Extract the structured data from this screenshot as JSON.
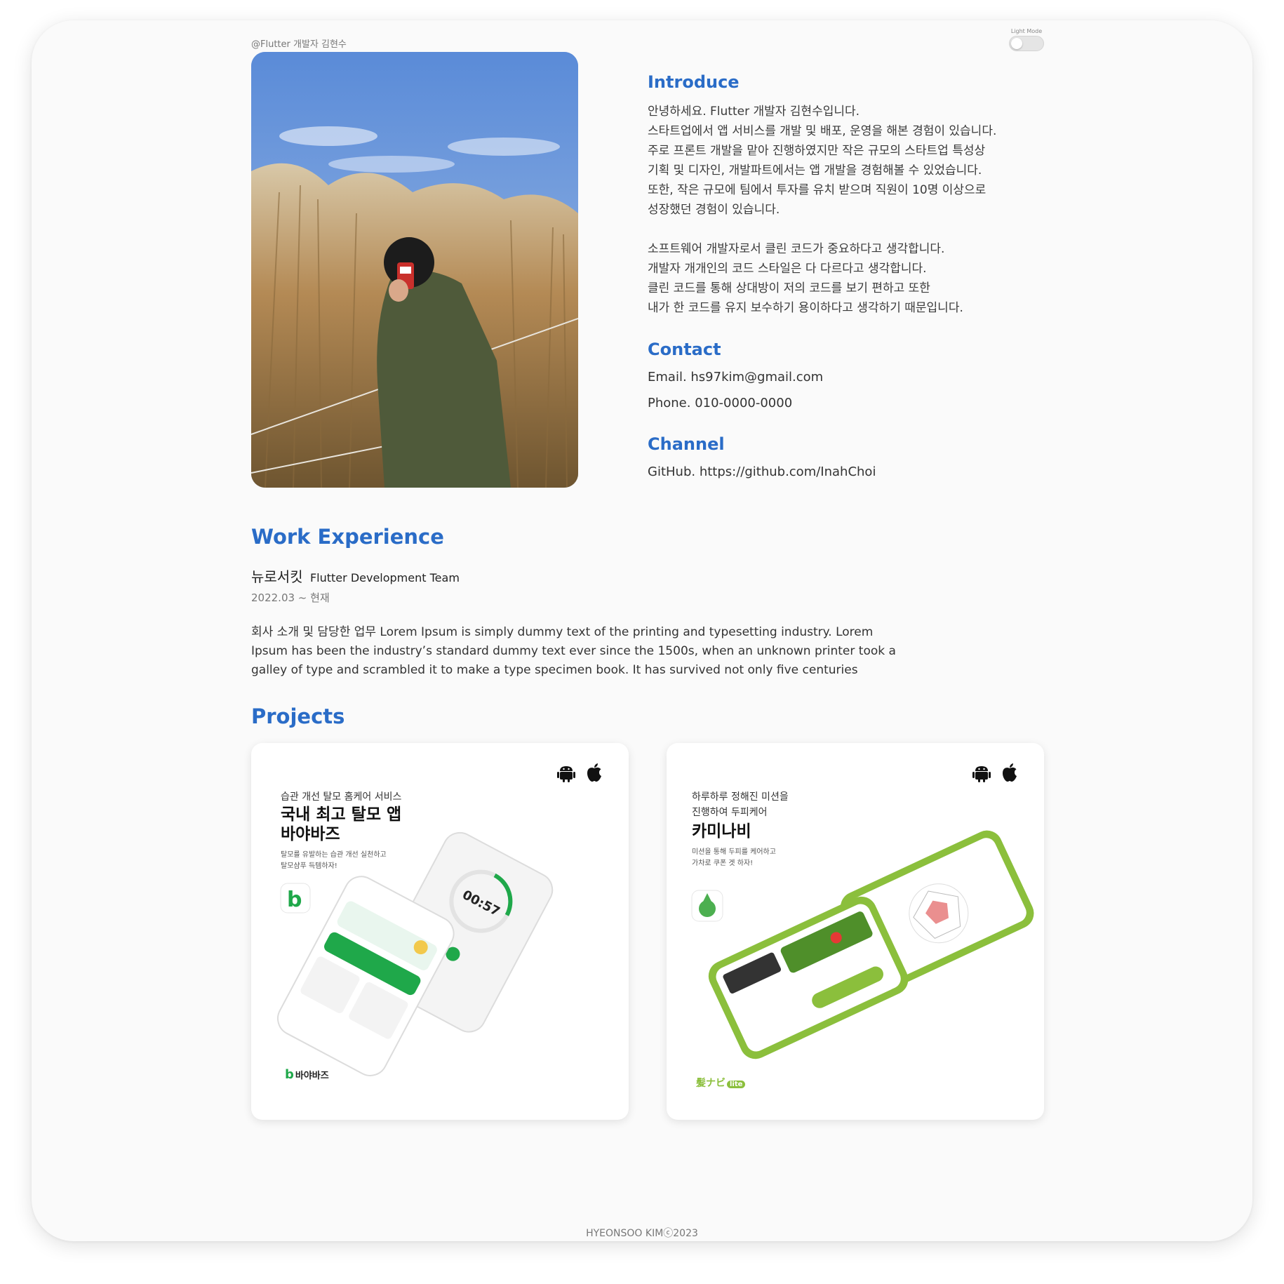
{
  "header": {
    "handle": "@Flutter 개발자 김현수",
    "theme_toggle_label": "Light Mode"
  },
  "profile": {
    "photo_icon": "profile-photo-icon"
  },
  "introduce": {
    "title": "Introduce",
    "paragraph1": [
      "안녕하세요. Flutter 개발자 김현수입니다.",
      "스타트업에서 앱 서비스를 개발 및 배포, 운영을 해본 경험이 있습니다.",
      "주로 프론트 개발을 맡아 진행하였지만 작은 규모의 스타트업 특성상",
      "기획 및 디자인, 개발파트에서는 앱 개발을 경험해볼 수 있었습니다.",
      "또한, 작은 규모에 팀에서 투자를 유치 받으며 직원이 10명 이상으로",
      "성장했던 경험이 있습니다."
    ],
    "paragraph2": [
      "소프트웨어 개발자로서 클린 코드가 중요하다고 생각합니다.",
      "개발자 개개인의 코드 스타일은 다 다르다고 생각합니다.",
      "클린 코드를 통해 상대방이 저의 코드를 보기 편하고 또한",
      "내가 한 코드를 유지 보수하기 용이하다고 생각하기 때문입니다."
    ]
  },
  "contact": {
    "title": "Contact",
    "email": "Email.  hs97kim@gmail.com",
    "phone": "Phone. 010-0000-0000"
  },
  "channel": {
    "title": "Channel",
    "github": "GitHub. https://github.com/InahChoi"
  },
  "work": {
    "title": "Work Experience",
    "company": "뉴로서킷",
    "team": "Flutter Development Team",
    "period": "2022.03 ~ 현재",
    "description": "회사 소개 및 담당한 업무 Lorem Ipsum is simply dummy text of the printing and typesetting industry. Lorem Ipsum has been the industry’s standard dummy text ever since the 1500s, when an unknown printer took a galley of type and scrambled it to make a type specimen book. It has survived not only five centuries"
  },
  "projects": {
    "title": "Projects",
    "items": [
      {
        "subtitle": "습관 개선 탈모 홈케어 서비스",
        "headline_line1": "국내 최고 탈모 앱",
        "headline_line2": "바야바즈",
        "desc_line1": "탈모를 유발하는 습관 개선 실천하고",
        "desc_line2": "탈모샴푸 득템하자!",
        "brand": "바야바즈",
        "brand_mark": "b",
        "timer": "00:57",
        "accent": "#1fa84a",
        "platforms": [
          "android-icon",
          "apple-icon"
        ]
      },
      {
        "subtitle_line1": "하루하루 정해진 미션을",
        "subtitle_line2": "진행하여 두피케어",
        "headline": "카미나비",
        "desc_line1": "미션을 통해 두피를 케어하고",
        "desc_line2": "가차로 쿠폰 겟 하자!",
        "brand": "髪ナビ",
        "brand_badge": "lite",
        "accent": "#8bbf3c",
        "platforms": [
          "android-icon",
          "apple-icon"
        ]
      }
    ]
  },
  "footer": {
    "text": "HYEONSOO KIMⓒ2023"
  }
}
